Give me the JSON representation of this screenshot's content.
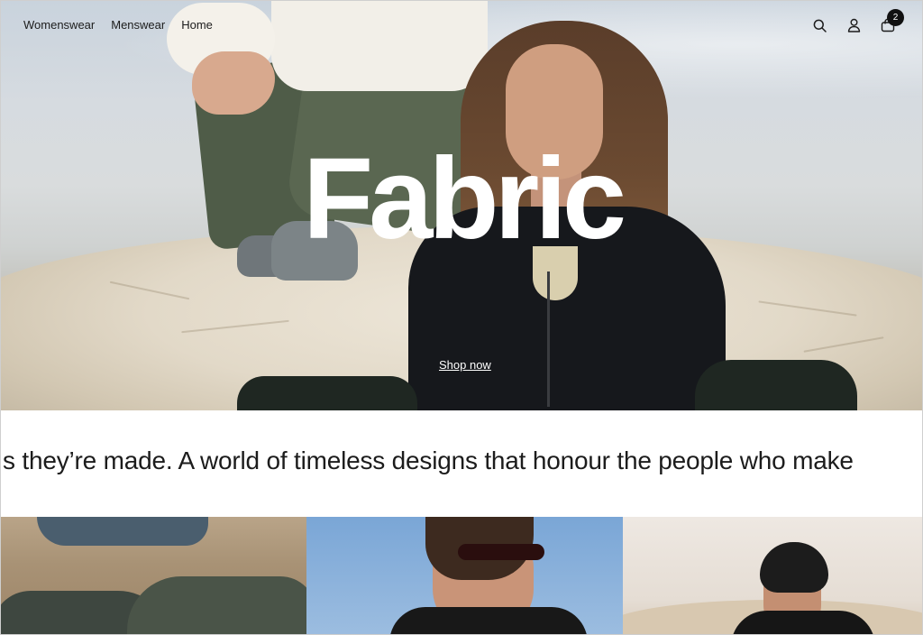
{
  "nav": {
    "links": [
      "Womenswear",
      "Menswear",
      "Home"
    ],
    "icons": [
      "search-icon",
      "account-icon",
      "cart-icon"
    ],
    "cart_count": "2"
  },
  "hero": {
    "title": "Fabric",
    "cta": "Shop now"
  },
  "marquee": {
    "text": "s they’re made.  A world of timeless designs that honour the people who make"
  },
  "colors": {
    "text": "#1c1c1c",
    "hero_title": "#ffffff",
    "badge_bg": "#111111"
  }
}
